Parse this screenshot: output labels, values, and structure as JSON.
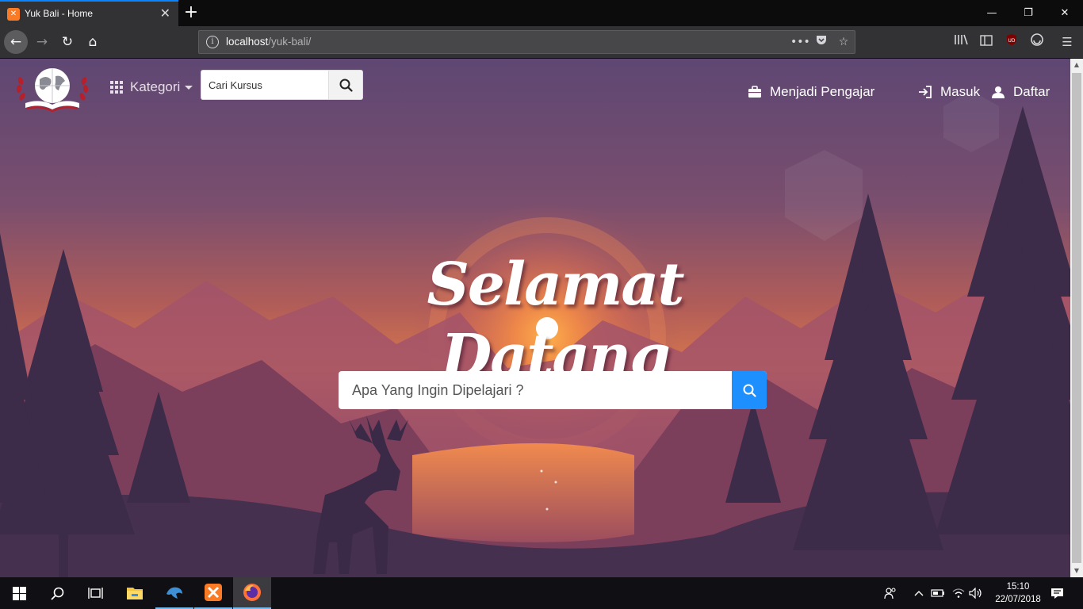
{
  "browser": {
    "tab_title": "Yuk Bali - Home",
    "tab_favicon": "xampp-icon",
    "url_host": "localhost",
    "url_path": "/yuk-bali/",
    "accent_color": "#0a84ff"
  },
  "header": {
    "kategori_label": "Kategori",
    "search_placeholder": "Cari Kursus",
    "teach_label": "Menjadi Pengajar",
    "login_label": "Masuk",
    "register_label": "Daftar"
  },
  "hero": {
    "title": "Selamat Datang",
    "search_placeholder": "Apa Yang Ingin Dipelajari ?",
    "search_button_color": "#1e8fff"
  },
  "taskbar": {
    "apps": [
      "start-icon",
      "search-icon",
      "task-view-icon",
      "file-explorer-icon",
      "mysql-workbench-icon",
      "xampp-icon",
      "firefox-icon"
    ],
    "time": "15:10",
    "date": "22/07/2018"
  }
}
